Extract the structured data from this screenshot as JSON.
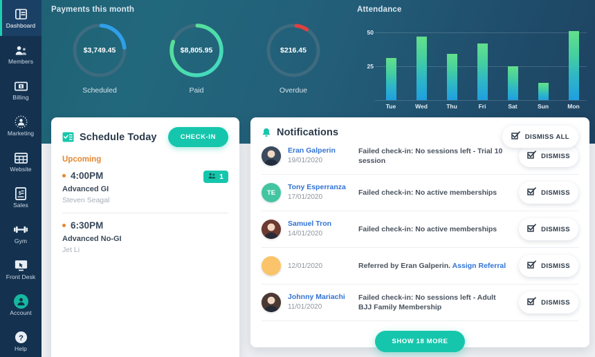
{
  "colors": {
    "accent_teal": "#16c6ac",
    "sidebar_bg": "#143250",
    "sidebar_active": "#1b4066",
    "sidebar_accent_bar": "#1ccfb0",
    "header_gradient_from": "#1e5f72",
    "header_gradient_to": "#1d4361",
    "page_bg": "#eceef1",
    "link_blue": "#3273d3",
    "upcoming_orange": "#e3872f",
    "donut_track": "#3d6b80",
    "donut_scheduled": "#2f9fe8",
    "donut_paid_from": "#5ee08a",
    "donut_paid_to": "#3ad8c8",
    "donut_overdue": "#e04040",
    "bar_top": "#63e08c",
    "bar_bottom": "#1f9fe0"
  },
  "sidebar": {
    "items": [
      {
        "label": "Dashboard",
        "icon": "dashboard-icon",
        "active": true
      },
      {
        "label": "Members",
        "icon": "members-icon",
        "active": false
      },
      {
        "label": "Billing",
        "icon": "billing-icon",
        "active": false
      },
      {
        "label": "Marketing",
        "icon": "marketing-icon",
        "active": false
      },
      {
        "label": "Website",
        "icon": "website-icon",
        "active": false
      },
      {
        "label": "Sales",
        "icon": "sales-icon",
        "active": false
      },
      {
        "label": "Gym",
        "icon": "gym-icon",
        "active": false
      },
      {
        "label": "Front Desk",
        "icon": "front-desk-icon",
        "active": false
      },
      {
        "label": "Account",
        "icon": "account-icon",
        "active": false
      },
      {
        "label": "Help",
        "icon": "help-icon",
        "active": false
      }
    ]
  },
  "payments": {
    "title": "Payments this month",
    "donuts": [
      {
        "value": "$3,749.45",
        "caption": "Scheduled",
        "percent": 22,
        "start": 0,
        "color": "#2f9fe8"
      },
      {
        "value": "$8,805.95",
        "caption": "Paid",
        "percent": 80,
        "start": 0,
        "color": "#4bdca4"
      },
      {
        "value": "$216.45",
        "caption": "Overdue",
        "percent": 7,
        "start": 0,
        "color": "#e04040"
      }
    ]
  },
  "chart_data": {
    "type": "bar",
    "title": "Attendance",
    "categories": [
      "Tue",
      "Wed",
      "Thu",
      "Fri",
      "Sat",
      "Sun",
      "Mon"
    ],
    "values": [
      31,
      47,
      34,
      42,
      25,
      13,
      51
    ],
    "xlabel": "",
    "ylabel": "",
    "ylim": [
      0,
      51
    ],
    "yticks": [
      25,
      50
    ],
    "grid": true,
    "legend": false
  },
  "schedule": {
    "title": "Schedule Today",
    "icon": "schedule-icon",
    "checkin_label": "CHECK-IN",
    "section_label": "Upcoming",
    "sessions": [
      {
        "time": "4:00PM",
        "name": "Advanced GI",
        "coach": "Steven Seagal",
        "attendees": "1",
        "has_badge": true
      },
      {
        "time": "6:30PM",
        "name": "Advanced No-GI",
        "coach": "Jet Li",
        "attendees": "",
        "has_badge": false
      }
    ]
  },
  "notifications": {
    "title": "Notifications",
    "icon": "bell-icon",
    "dismiss_all_label": "DISMISS ALL",
    "dismiss_label": "DISMISS",
    "show_more_label": "SHOW 18 MORE",
    "items": [
      {
        "name": "Eran Galperin",
        "date": "19/01/2020",
        "message": "Failed check-in: No sessions left - Trial 10 session",
        "link_text": "",
        "avatar_type": "photo",
        "avatar_initials": "",
        "avatar_color": "#3b4a5c"
      },
      {
        "name": "Tony Esperranza",
        "date": "17/01/2020",
        "message": "Failed check-in: No active memberships",
        "link_text": "",
        "avatar_type": "initials",
        "avatar_initials": "TE",
        "avatar_color": "#44c5a2"
      },
      {
        "name": "Samuel Tron",
        "date": "14/01/2020",
        "message": "Failed check-in: No active memberships",
        "link_text": "",
        "avatar_type": "photo",
        "avatar_initials": "",
        "avatar_color": "#6b3a30"
      },
      {
        "name": "",
        "date": "12/01/2020",
        "message": "Referred by Eran Galperin.",
        "link_text": "Assign Referral",
        "avatar_type": "blank",
        "avatar_initials": "",
        "avatar_color": "#fbc46a"
      },
      {
        "name": "Johnny Mariachi",
        "date": "11/01/2020",
        "message": "Failed check-in: No sessions left - Adult BJJ Family Membership",
        "link_text": "",
        "avatar_type": "photo",
        "avatar_initials": "",
        "avatar_color": "#4a3a33"
      }
    ]
  }
}
